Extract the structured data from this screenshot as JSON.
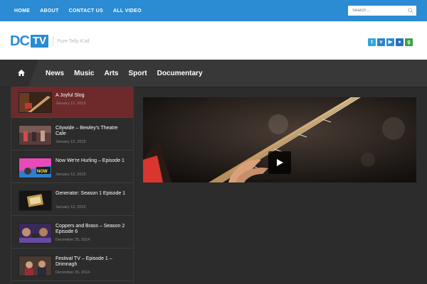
{
  "topnav": {
    "items": [
      "HOME",
      "ABOUT",
      "CONTACT US",
      "ALL VIDEO"
    ]
  },
  "search": {
    "placeholder": "Search ..."
  },
  "logo": {
    "dc": "DC",
    "tv": "TV",
    "tagline": "Pure Telly K'all"
  },
  "socials": [
    {
      "icon": "twitter-icon",
      "glyph": "t",
      "color": "#2fa7e0"
    },
    {
      "icon": "vimeo-icon",
      "glyph": "v",
      "color": "#2e83c6"
    },
    {
      "icon": "youtube-icon",
      "glyph": "▶",
      "color": "#2b8bd3"
    },
    {
      "icon": "flickr-icon",
      "glyph": "●",
      "color": "#2b6fc2"
    },
    {
      "icon": "google-plus-icon",
      "glyph": "g",
      "color": "#3a9f46"
    }
  ],
  "mainnav": {
    "items": [
      "News",
      "Music",
      "Arts",
      "Sport",
      "Documentary"
    ]
  },
  "sidebar": {
    "items": [
      {
        "title": "A Joyful Slog",
        "date": "January 12, 2015",
        "active": true
      },
      {
        "title": "Citywide – Bewley's Theatre Cafe",
        "date": "January 12, 2015",
        "active": false
      },
      {
        "title": "Now We're Hurling – Episode 1",
        "date": "January 12, 2015",
        "active": false
      },
      {
        "title": "Generator: Season 1 Episode 1",
        "date": "January 12, 2015",
        "active": false
      },
      {
        "title": "Coppers and Brass – Season 2 Episode 6",
        "date": "December 25, 2014",
        "active": false
      },
      {
        "title": "Festival TV – Episode 1 – Drimnagh",
        "date": "December 25, 2014",
        "active": false
      }
    ]
  },
  "colors": {
    "brand": "#2b8bd3",
    "active_item": "#6e2a2a",
    "nav_bg": "#383838",
    "page_bg": "#2c2c2c"
  }
}
